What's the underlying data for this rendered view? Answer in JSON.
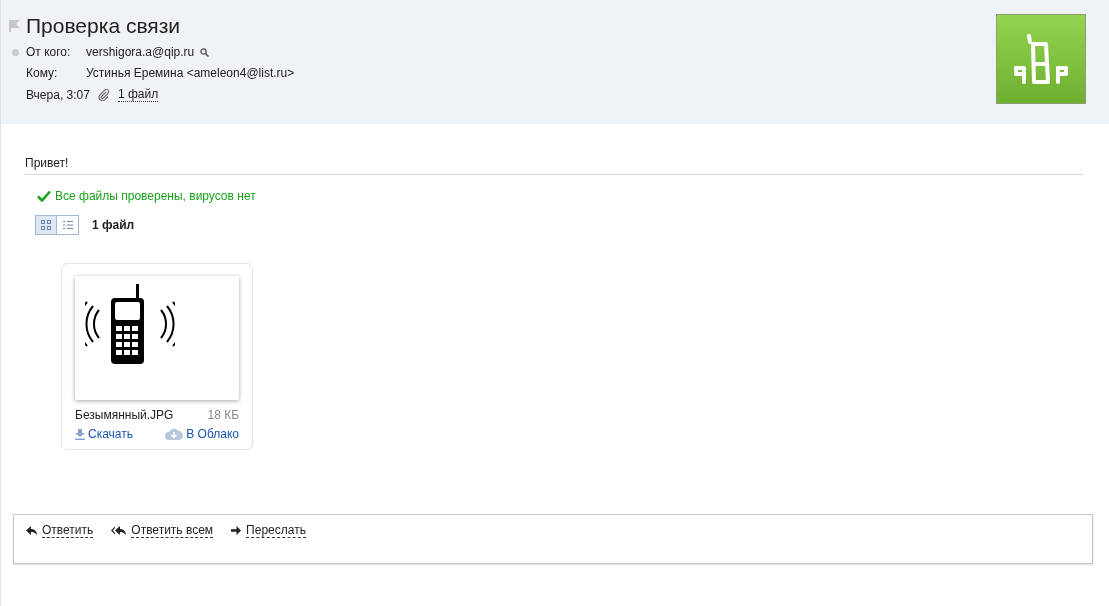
{
  "header": {
    "subject": "Проверка связи",
    "flagged": false,
    "from_label": "От кого:",
    "from": "vershigora.a@qip.ru",
    "to_label": "Кому:",
    "to": "Устинья Еремина <ameleon4@list.ru>",
    "date": "Вчера, 3:07",
    "attachments_link": "1 файл"
  },
  "body": {
    "text": "Привет!"
  },
  "attachments": {
    "scan_status": "Все файлы проверены, вирусов нет",
    "views": [
      {
        "kind": "grid",
        "selected": true
      },
      {
        "kind": "list",
        "selected": false
      }
    ],
    "count": "1 файл",
    "files": [
      {
        "name": "Безымянный.JPG",
        "size": "18 КБ",
        "download": "Скачать",
        "cloud": "В Облако"
      }
    ]
  },
  "actions": [
    {
      "kind": "reply",
      "label": "Ответить"
    },
    {
      "kind": "reply_all",
      "label": "Ответить всем"
    },
    {
      "kind": "forward",
      "label": "Переслать"
    }
  ]
}
